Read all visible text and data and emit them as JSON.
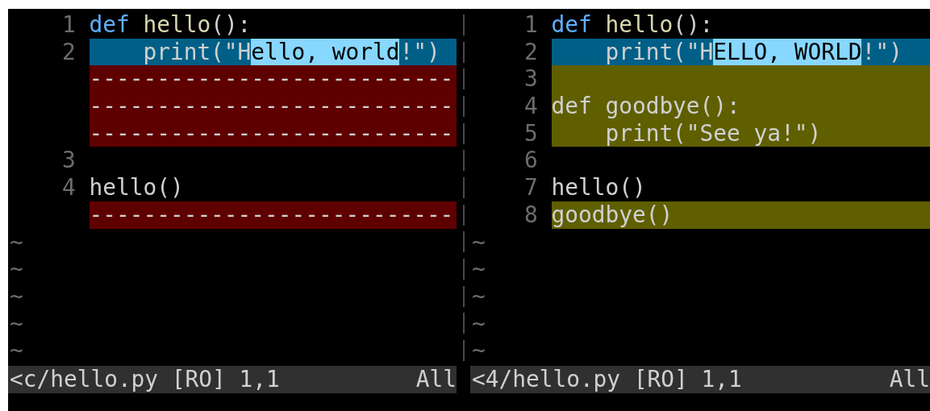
{
  "panes": [
    {
      "rows": [
        {
          "kind": "normal",
          "number": "1",
          "segments": [
            {
              "text": "def",
              "kind": "keyword"
            },
            {
              "text": " hello",
              "kind": "function"
            },
            {
              "text": "():",
              "kind": "plain"
            }
          ]
        },
        {
          "kind": "changed",
          "number": "2",
          "segments": [
            {
              "text": "    print(\"H",
              "kind": "plain"
            },
            {
              "text": "ello, world",
              "kind": "changed"
            },
            {
              "text": "!\")",
              "kind": "plain"
            }
          ]
        },
        {
          "kind": "deleted",
          "segments": [
            {
              "text": "---------------------------",
              "kind": "plain"
            }
          ]
        },
        {
          "kind": "deleted",
          "segments": [
            {
              "text": "---------------------------",
              "kind": "plain"
            }
          ]
        },
        {
          "kind": "deleted",
          "segments": [
            {
              "text": "---------------------------",
              "kind": "plain"
            }
          ]
        },
        {
          "kind": "normal",
          "number": "3"
        },
        {
          "kind": "normal",
          "number": "4",
          "segments": [
            {
              "text": "hello()",
              "kind": "plain"
            }
          ]
        },
        {
          "kind": "deleted",
          "segments": [
            {
              "text": "---------------------------",
              "kind": "plain"
            }
          ]
        },
        {
          "kind": "tilde",
          "marker": "~"
        },
        {
          "kind": "tilde",
          "marker": "~"
        },
        {
          "kind": "tilde",
          "marker": "~"
        },
        {
          "kind": "tilde",
          "marker": "~"
        },
        {
          "kind": "tilde",
          "marker": "~"
        }
      ],
      "status": {
        "file": "<c/hello.py [RO] 1,1",
        "position": "All"
      }
    },
    {
      "rows": [
        {
          "kind": "normal",
          "number": "1",
          "segments": [
            {
              "text": "def",
              "kind": "keyword"
            },
            {
              "text": " hello",
              "kind": "function"
            },
            {
              "text": "():",
              "kind": "plain"
            }
          ]
        },
        {
          "kind": "changed",
          "number": "2",
          "segments": [
            {
              "text": "    print(\"H",
              "kind": "plain"
            },
            {
              "text": "ELLO, WORLD",
              "kind": "changed"
            },
            {
              "text": "!\")",
              "kind": "plain"
            }
          ]
        },
        {
          "kind": "added",
          "number": "3"
        },
        {
          "kind": "added",
          "number": "4",
          "segments": [
            {
              "text": "def goodbye():",
              "kind": "plain"
            }
          ]
        },
        {
          "kind": "added",
          "number": "5",
          "segments": [
            {
              "text": "    print(\"See ya!\")",
              "kind": "plain"
            }
          ]
        },
        {
          "kind": "normal",
          "number": "6"
        },
        {
          "kind": "normal",
          "number": "7",
          "segments": [
            {
              "text": "hello()",
              "kind": "plain"
            }
          ]
        },
        {
          "kind": "added",
          "number": "8",
          "segments": [
            {
              "text": "goodbye()",
              "kind": "plain"
            }
          ]
        },
        {
          "kind": "tilde",
          "marker": "~"
        },
        {
          "kind": "tilde",
          "marker": "~"
        },
        {
          "kind": "tilde",
          "marker": "~"
        },
        {
          "kind": "tilde",
          "marker": "~"
        },
        {
          "kind": "tilde",
          "marker": "~"
        }
      ],
      "status": {
        "file": "<4/hello.py [RO] 1,1",
        "position": "All"
      }
    }
  ]
}
